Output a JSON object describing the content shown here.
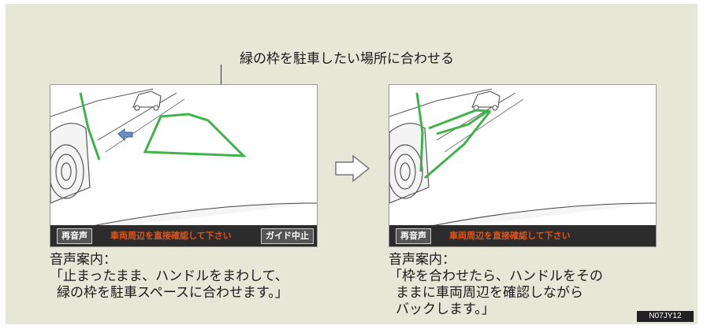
{
  "callout": "緑の枠を駐車したい場所に合わせる",
  "left_screen": {
    "replay_button": "再音声",
    "notice": "車両周辺を直接確認して下さい",
    "cancel_button": "ガイド中止"
  },
  "right_screen": {
    "replay_button": "再音声",
    "notice": "車両周辺を直接確認して下さい"
  },
  "left_caption": {
    "label": "音声案内：",
    "line1": "「止まったまま、ハンドルをまわして、",
    "line2": "緑の枠を駐車スペースに合わせます。」"
  },
  "right_caption": {
    "label": "音声案内：",
    "line1": "「枠を合わせたら、ハンドルをその",
    "line2": "ままに車両周辺を確認しながら",
    "line3": "バックします。」"
  },
  "figure_code": "N07JY12",
  "colors": {
    "guide_frame": "#3fb34a",
    "notice_text": "#e0561c",
    "panel_bg": "#e6e7d7"
  }
}
